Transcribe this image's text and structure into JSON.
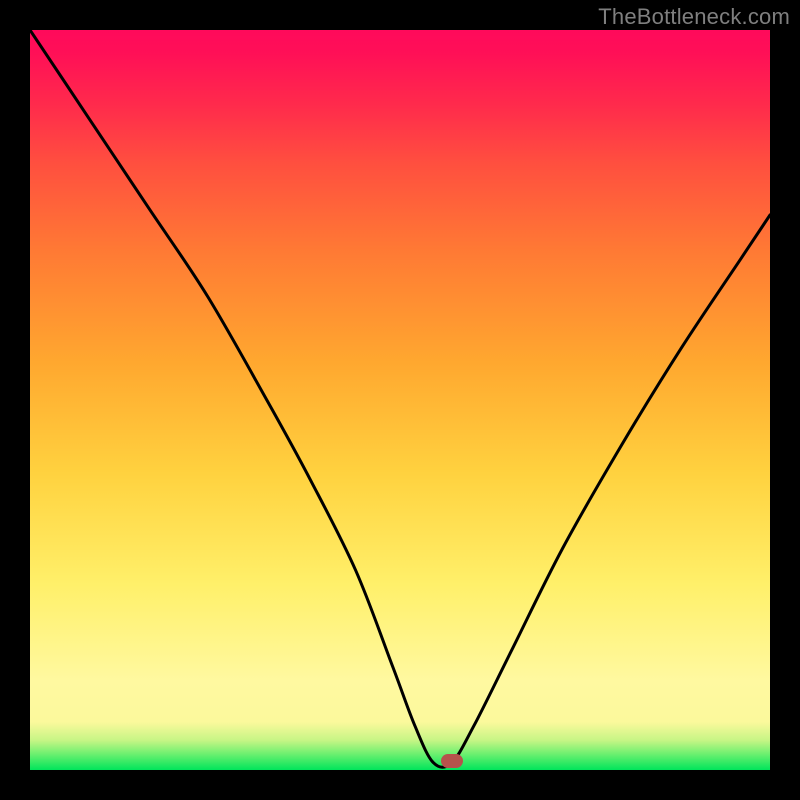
{
  "watermark": "TheBottleneck.com",
  "chart_data": {
    "type": "line",
    "title": "",
    "xlabel": "",
    "ylabel": "",
    "xlim": [
      0,
      100
    ],
    "ylim": [
      0,
      100
    ],
    "grid": false,
    "legend": false,
    "series": [
      {
        "name": "bottleneck-curve",
        "x": [
          0,
          8,
          16,
          24,
          32,
          38,
          44,
          49,
          52,
          54.5,
          57,
          60,
          65,
          72,
          80,
          88,
          96,
          100
        ],
        "values": [
          100,
          88,
          76,
          64,
          50,
          39,
          27,
          14,
          6,
          1,
          1,
          6,
          16,
          30,
          44,
          57,
          69,
          75
        ]
      }
    ],
    "marker": {
      "x": 57,
      "y": 1.2
    },
    "gradient": {
      "stops": [
        {
          "pos": 0,
          "color": "#00e55b"
        },
        {
          "pos": 0.05,
          "color": "#fbf99c"
        },
        {
          "pos": 0.25,
          "color": "#fff06a"
        },
        {
          "pos": 0.55,
          "color": "#ffa82f"
        },
        {
          "pos": 0.85,
          "color": "#ff3a48"
        },
        {
          "pos": 1.0,
          "color": "#ff0a5b"
        }
      ]
    }
  }
}
